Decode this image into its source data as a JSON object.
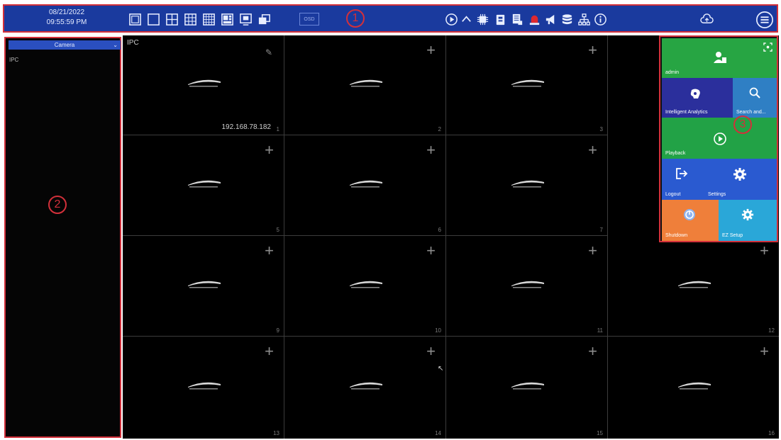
{
  "topbar": {
    "date": "08/21/2022",
    "time": "09:55:59 PM",
    "osd_label": "OSD",
    "icons_left": [
      "layout-1-icon",
      "layout-single-icon",
      "layout-4-icon",
      "layout-9-icon",
      "layout-16-icon",
      "screen-picture-icon",
      "multi-window-icon"
    ],
    "icons_right": [
      "play-icon",
      "chevron-up-icon",
      "chip-icon",
      "storage-icon",
      "document-icon",
      "alarm-icon",
      "megaphone-icon",
      "database-icon",
      "network-icon",
      "info-icon",
      "cloud-upload-icon",
      "menu-icon"
    ]
  },
  "callouts": {
    "one": "1",
    "two": "2",
    "three": "3"
  },
  "left_panel": {
    "camera_select": "Camera",
    "tree_root": "IPC"
  },
  "grid": {
    "first_cell_label": "IPC",
    "first_cell_ip": "192.168.78.182",
    "cells": [
      {
        "num": "1"
      },
      {
        "num": "2"
      },
      {
        "num": "3"
      },
      {
        "num": "5"
      },
      {
        "num": "6"
      },
      {
        "num": "7"
      },
      {
        "num": "9"
      },
      {
        "num": "10"
      },
      {
        "num": "11"
      },
      {
        "num": "12"
      },
      {
        "num": "13"
      },
      {
        "num": "14"
      },
      {
        "num": "15"
      },
      {
        "num": "16"
      }
    ]
  },
  "menu": {
    "admin": "admin",
    "intelligent": "Intelligent Analytics",
    "search": "Search and...",
    "playback": "Playback",
    "logout": "Logout",
    "settings": "Settings",
    "shutdown": "Shutdown",
    "ez_setup": "EZ Setup",
    "colors": {
      "admin": "#27a543",
      "intelligent": "#2b2f9c",
      "search": "#2f7fc4",
      "playback": "#22a246",
      "logout": "#2a5ad0",
      "settings": "#2a5ad0",
      "shutdown": "#ef7f3a",
      "ez": "#2aa7d8"
    }
  }
}
